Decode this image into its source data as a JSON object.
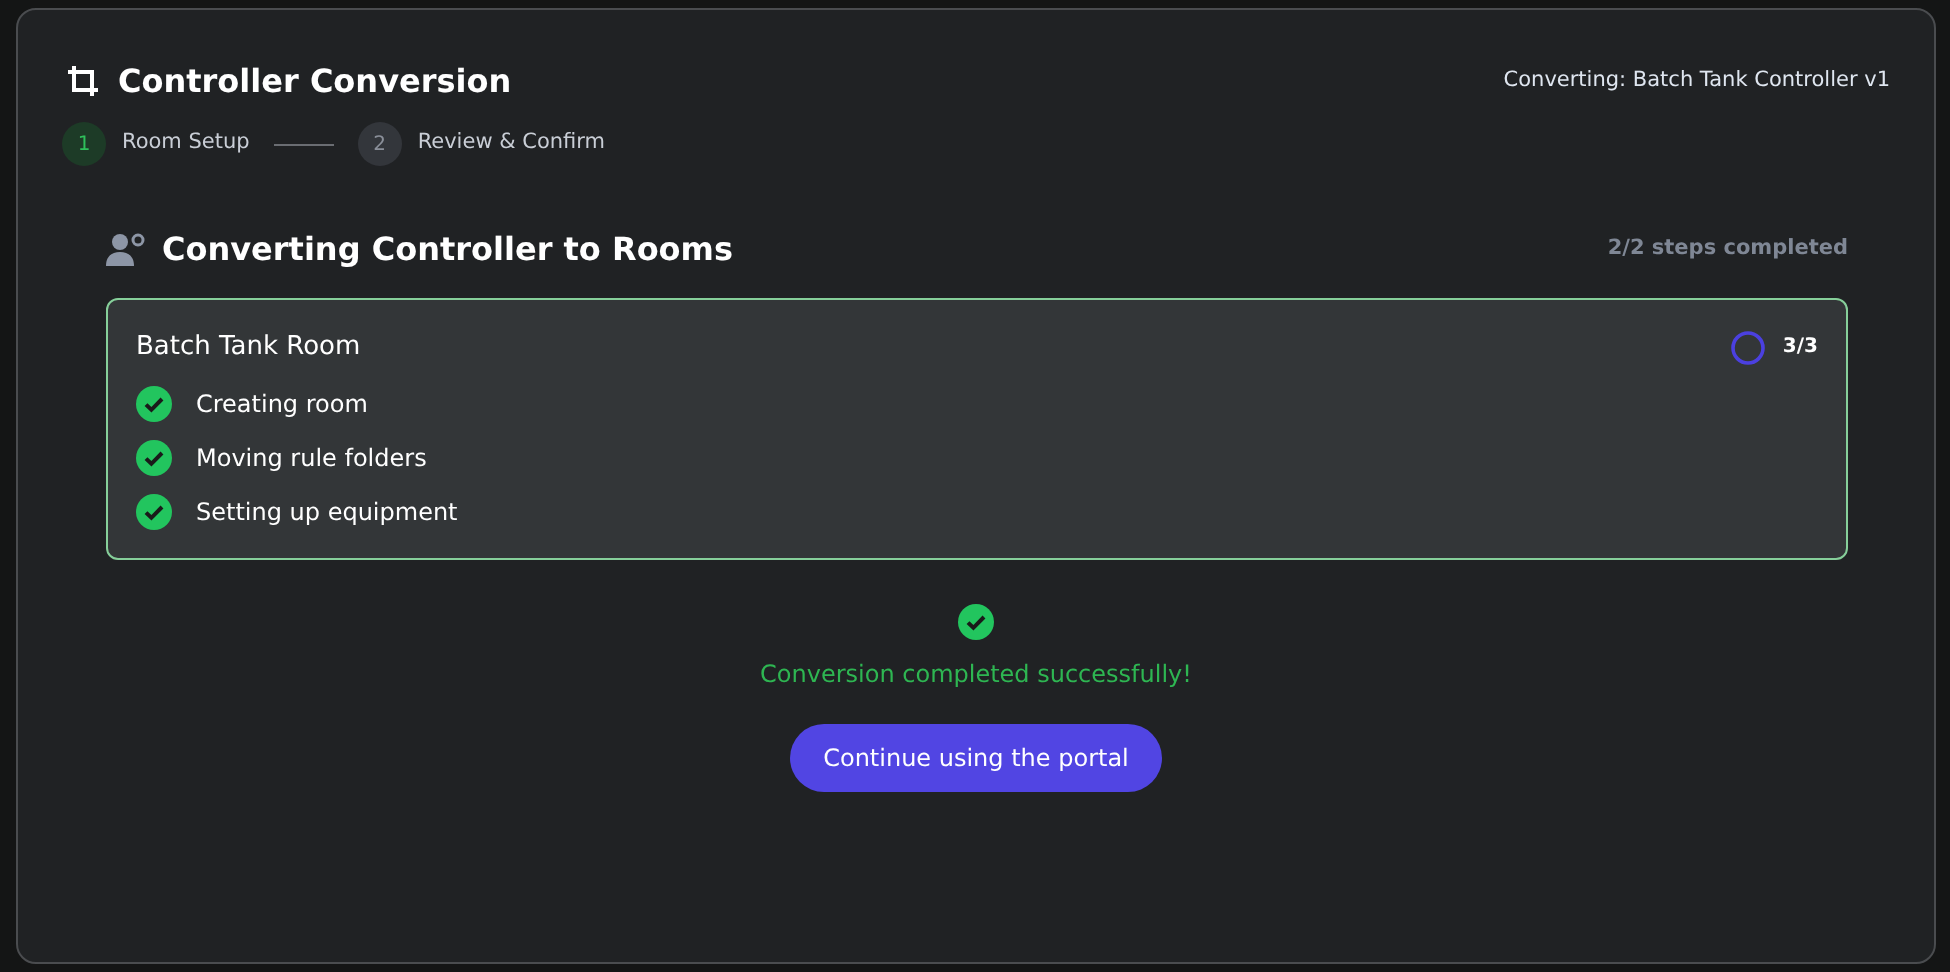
{
  "dialog": {
    "title": "Controller Conversion",
    "subtitle": "Converting: Batch Tank Controller v1"
  },
  "steps": [
    {
      "number": "1",
      "label": "Room Setup",
      "selected": true
    },
    {
      "number": "2",
      "label": "Review & Confirm",
      "selected": false
    }
  ],
  "section": {
    "title": "Converting Controller to Rooms",
    "progress": "2/2 steps completed"
  },
  "room": {
    "name": "Batch Tank Room",
    "count": "3/3",
    "tasks": [
      {
        "label": "Creating room",
        "done": true
      },
      {
        "label": "Moving rule folders",
        "done": true
      },
      {
        "label": "Setting up equipment",
        "done": true
      }
    ]
  },
  "result": {
    "message": "Conversion completed successfully!",
    "button": "Continue using the portal"
  }
}
